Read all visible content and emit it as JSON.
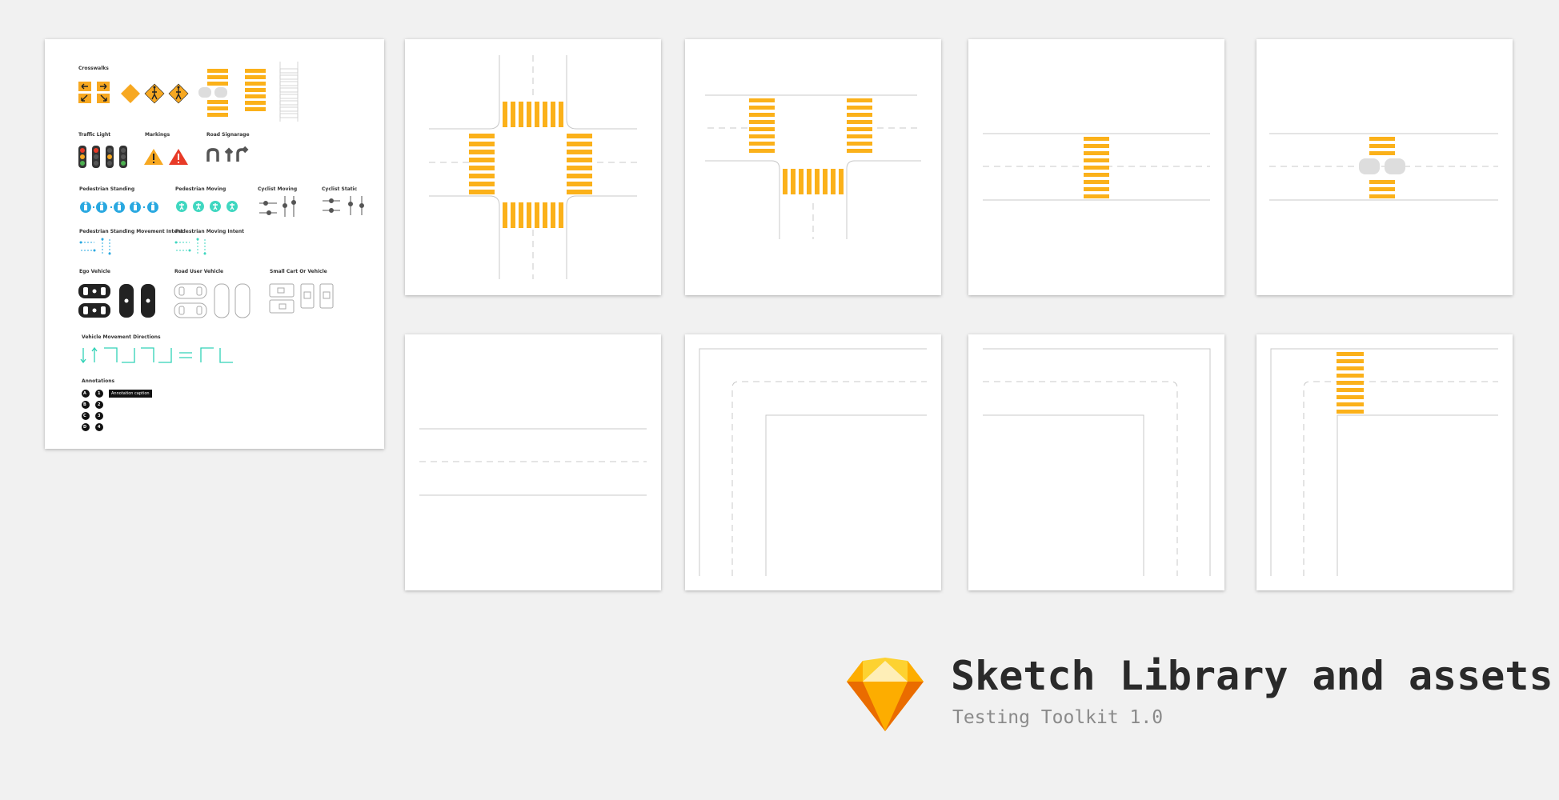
{
  "library": {
    "sections": {
      "crosswalks": "Crosswalks",
      "traffic_light": "Traffic Light",
      "markings": "Markings",
      "road_signage": "Road Signarage",
      "pedestrian_standing": "Pedestrian Standing",
      "pedestrian_moving": "Pedestrian Moving",
      "cyclist_moving": "Cyclist Moving",
      "cyclist_static": "Cyclist Static",
      "ped_standing_intent": "Pedestrian Standing Movement Intent",
      "ped_moving_intent": "Pedestrian Moving Intent",
      "ego_vehicle": "Ego Vehicle",
      "road_user_vehicle": "Road User Vehicle",
      "small_cart": "Small Cart Or Vehicle",
      "vehicle_directions": "Vehicle Movement Directions",
      "annotations": "Annotations"
    },
    "annotation_letters": [
      "A",
      "B",
      "C",
      "D"
    ],
    "annotation_numbers": [
      "1",
      "2",
      "3",
      "4"
    ],
    "annotation_tooltip": "Annotation caption"
  },
  "artboards": [
    {
      "name": "four-way-intersection"
    },
    {
      "name": "t-intersection"
    },
    {
      "name": "straight-road-crosswalk"
    },
    {
      "name": "straight-road-crosswalk-island"
    },
    {
      "name": "straight-road"
    },
    {
      "name": "corner-turn-right"
    },
    {
      "name": "corner-turn-left"
    },
    {
      "name": "corner-with-crosswalk"
    }
  ],
  "footer": {
    "title": "Sketch Library and assets",
    "subtitle": "Testing Toolkit 1.0"
  },
  "colors": {
    "background": "#f1f1f1",
    "crosswalk_yellow": "#fbb11a",
    "road_line": "#c8c8c8",
    "pedestrian_blue": "#29a8e0",
    "pedestrian_teal": "#3fd7c0",
    "vehicle_direction_teal": "#30d2b6",
    "sign_orange": "#f7a821",
    "warning_red": "#e83a27"
  }
}
